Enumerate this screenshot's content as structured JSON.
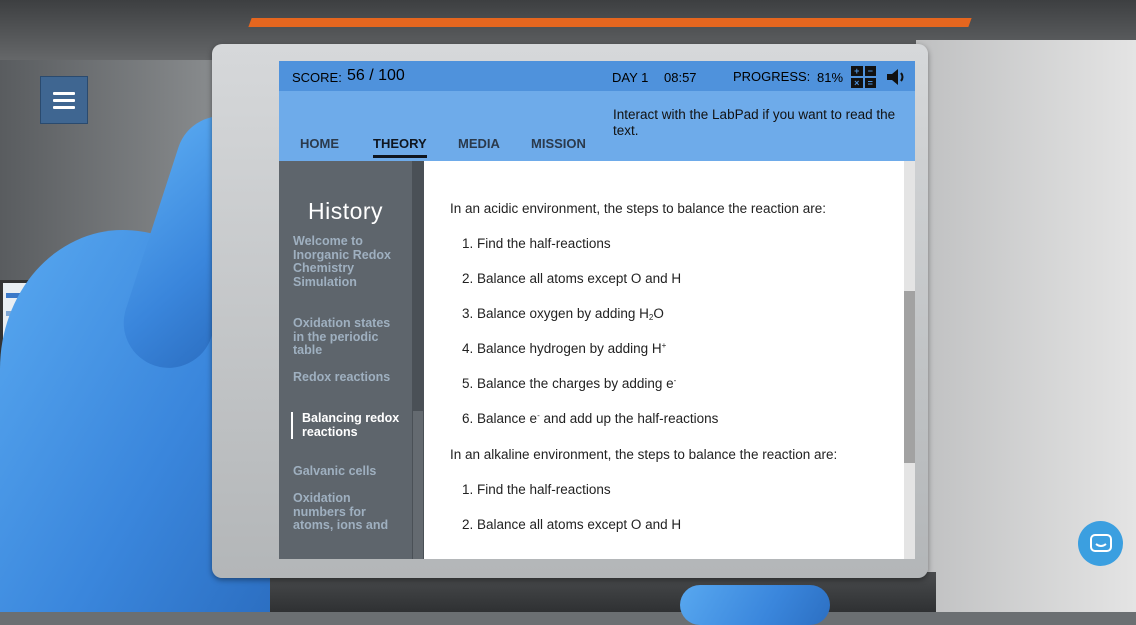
{
  "topbar": {
    "score_label": "SCORE:",
    "score_value": "56 / 100",
    "day": "DAY 1",
    "time": "08:57",
    "progress_label": "PROGRESS:",
    "progress_value": "81%"
  },
  "nav": {
    "tabs": [
      {
        "label": "HOME",
        "active": false
      },
      {
        "label": "THEORY",
        "active": true
      },
      {
        "label": "MEDIA",
        "active": false
      },
      {
        "label": "MISSION",
        "active": false
      }
    ],
    "hint": "Interact with the LabPad if you want to read the text."
  },
  "sidebar": {
    "title": "History",
    "items": [
      {
        "label": "Welcome to Inorganic Redox Chemistry Simulation",
        "active": false
      },
      {
        "label": "Oxidation states in the periodic table",
        "active": false
      },
      {
        "label": "Redox reactions",
        "active": false
      },
      {
        "label": "Balancing redox reactions",
        "active": true
      },
      {
        "label": "Galvanic cells",
        "active": false
      },
      {
        "label": "Oxidation numbers for atoms, ions and",
        "active": false
      }
    ]
  },
  "content": {
    "acidic_intro": "In an acidic environment, the steps to balance the reaction are:",
    "acidic_steps": [
      "1. Find the half-reactions",
      "2. Balance all atoms except O and H",
      "3. Balance oxygen by adding H",
      "4. Balance hydrogen by adding H",
      "5. Balance the charges by adding e",
      "6. Balance e"
    ],
    "step3_sub": "2",
    "step3_tail": "O",
    "step4_sup": "+",
    "step5_sup": "-",
    "step6_sup": "-",
    "step6_tail": " and add up the half-reactions",
    "alkaline_intro": "In an alkaline environment, the steps to balance the reaction are:",
    "alkaline_steps": [
      "1. Find the half-reactions",
      "2. Balance all atoms except O and H"
    ]
  },
  "icons": {
    "menu": "hamburger-icon",
    "calculator": "calculator-icon",
    "sound": "speaker-icon",
    "chat": "chat-icon"
  },
  "colors": {
    "topbar": "#4f92dc",
    "navbar": "#6eabea",
    "sidebar": "#5e656c",
    "glove": "#3a86dc",
    "accent_orange": "#e5661f",
    "chat": "#3b9fe0"
  }
}
